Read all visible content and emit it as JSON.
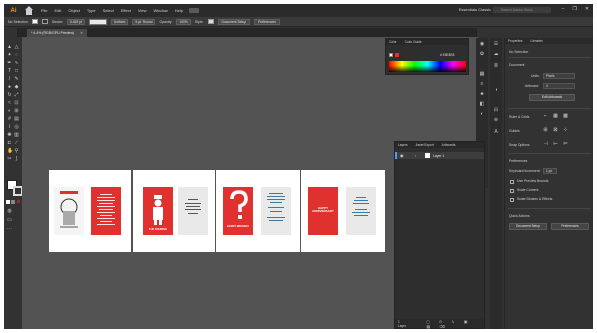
{
  "app": {
    "logo": "Ai",
    "menus": [
      "File",
      "Edit",
      "Object",
      "Type",
      "Select",
      "Effect",
      "View",
      "Window",
      "Help"
    ],
    "workspace": "Essentials Classic",
    "search_placeholder": "Search Adobe Stock",
    "window_controls": [
      "–",
      "❐",
      "✕"
    ]
  },
  "control_bar": {
    "selection": "No Selection",
    "stroke_label": "Stroke:",
    "stroke_value": "0.425 pt",
    "line_style": "Uniform",
    "brush": "5 pt. Round",
    "opacity_label": "Opacity:",
    "opacity_value": "100%",
    "style_label": "Style:",
    "doc_setup": "Document Setup",
    "preferences": "Preferences"
  },
  "document": {
    "tab_label": "* 6.4% (RGB/GPU Preview)",
    "tab_close": "✕"
  },
  "color_panel": {
    "tabs": [
      "Color",
      "Color Guide"
    ],
    "hex": "# E8E8E8"
  },
  "layers_panel": {
    "tabs": [
      "Layers",
      "Asset Export",
      "Artboards"
    ],
    "layer_name": "Layer 1",
    "footer": "1 Layer"
  },
  "properties": {
    "tabs": [
      "Properties",
      "Libraries"
    ],
    "no_selection": "No Selection",
    "document_label": "Document",
    "units_label": "Units:",
    "units_value": "Pixels",
    "artboard_label": "Artboard:",
    "artboard_value": "4",
    "edit_artboards": "Edit Artboards",
    "ruler_grids": "Ruler & Grids",
    "guides": "Guides",
    "snap_options": "Snap Options",
    "preferences_label": "Preferences",
    "keyboard_increment_label": "Keyboard Increment:",
    "keyboard_increment_value": "1 px",
    "use_preview_bounds": "Use Preview Bounds",
    "scale_corners": "Scale Corners",
    "scale_strokes": "Scale Strokes & Effects",
    "quick_actions": "Quick Actions",
    "document_setup_btn": "Document Setup",
    "preferences_btn": "Preferences"
  },
  "artboards": {
    "book2_title": "THE SOURING",
    "book3_title": "HARRY MIRANDA",
    "book4_title": "HAPPY ANNIVERSARY"
  },
  "colors": {
    "accent_red": "#e0312f",
    "canvas": "#535353",
    "panel": "#323232"
  }
}
